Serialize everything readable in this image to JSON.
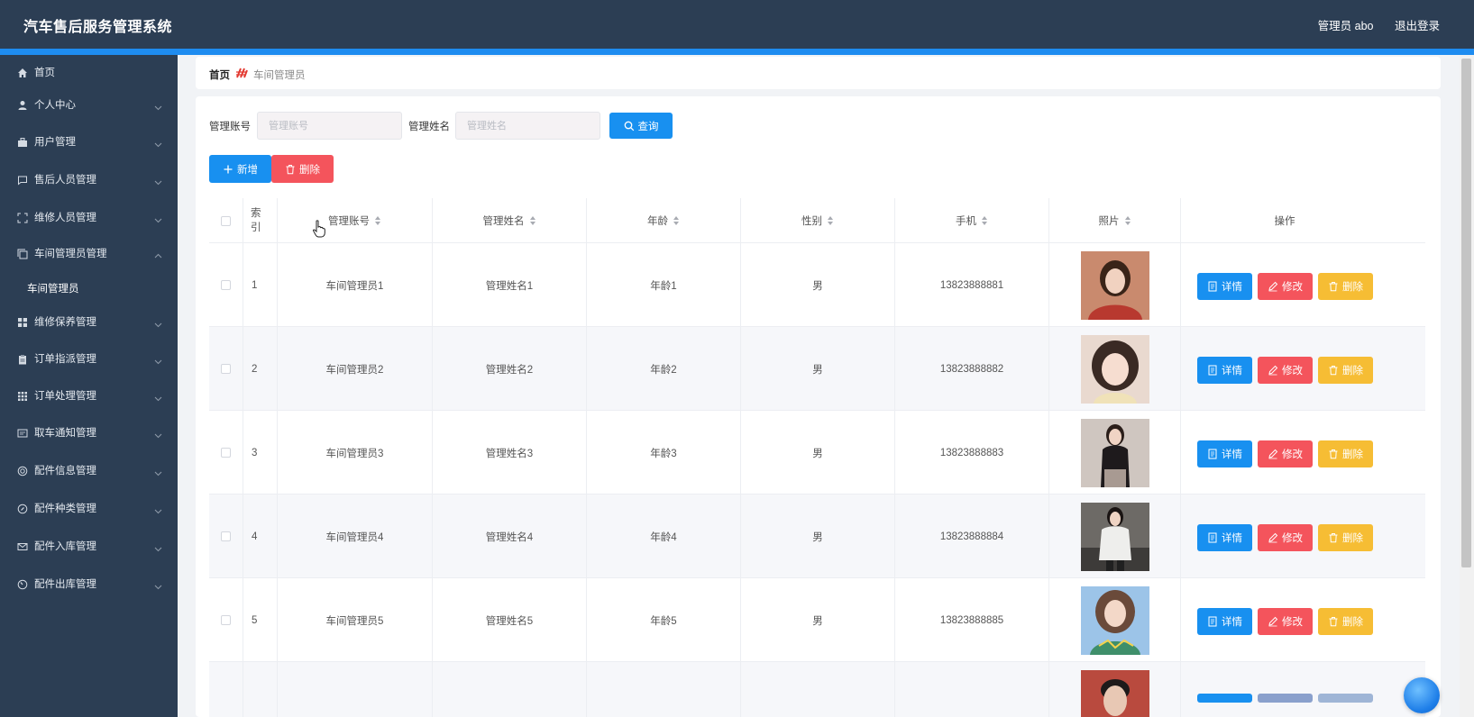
{
  "app": {
    "title": "汽车售后服务管理系统",
    "user_label": "管理员 abo",
    "logout_label": "退出登录"
  },
  "sidebar": {
    "items": [
      {
        "label": "首页",
        "icon": "home-icon"
      },
      {
        "label": "个人中心",
        "icon": "user-icon"
      },
      {
        "label": "用户管理",
        "icon": "users-icon"
      },
      {
        "label": "售后人员管理",
        "icon": "chat-icon"
      },
      {
        "label": "维修人员管理",
        "icon": "fullscreen-icon"
      },
      {
        "label": "车间管理员管理",
        "icon": "copy-icon"
      },
      {
        "label": "维修保养管理",
        "icon": "grid-icon"
      },
      {
        "label": "订单指派管理",
        "icon": "clipboard-icon"
      },
      {
        "label": "订单处理管理",
        "icon": "apps-icon"
      },
      {
        "label": "取车通知管理",
        "icon": "message-icon"
      },
      {
        "label": "配件信息管理",
        "icon": "circle-icon"
      },
      {
        "label": "配件种类管理",
        "icon": "compass-icon"
      },
      {
        "label": "配件入库管理",
        "icon": "mail-icon"
      },
      {
        "label": "配件出库管理",
        "icon": "gauge-icon"
      }
    ],
    "sub_item": "车间管理员"
  },
  "breadcrumb": {
    "home": "首页",
    "current": "车间管理员"
  },
  "search": {
    "account_label": "管理账号",
    "account_placeholder": "管理账号",
    "name_label": "管理姓名",
    "name_placeholder": "管理姓名",
    "query_label": "查询"
  },
  "toolbar": {
    "add_label": "新增",
    "delete_label": "删除"
  },
  "table": {
    "headers": {
      "index": "索引",
      "account": "管理账号",
      "name": "管理姓名",
      "age": "年龄",
      "gender": "性别",
      "phone": "手机",
      "photo": "照片",
      "actions": "操作"
    },
    "actions": {
      "detail": "详情",
      "edit": "修改",
      "delete": "删除"
    },
    "rows": [
      {
        "index": "1",
        "account": "车间管理员1",
        "name": "管理姓名1",
        "age": "年龄1",
        "gender": "男",
        "phone": "13823888881"
      },
      {
        "index": "2",
        "account": "车间管理员2",
        "name": "管理姓名2",
        "age": "年龄2",
        "gender": "男",
        "phone": "13823888882"
      },
      {
        "index": "3",
        "account": "车间管理员3",
        "name": "管理姓名3",
        "age": "年龄3",
        "gender": "男",
        "phone": "13823888883"
      },
      {
        "index": "4",
        "account": "车间管理员4",
        "name": "管理姓名4",
        "age": "年龄4",
        "gender": "男",
        "phone": "13823888884"
      },
      {
        "index": "5",
        "account": "车间管理员5",
        "name": "管理姓名5",
        "age": "年龄5",
        "gender": "男",
        "phone": "13823888885"
      }
    ]
  },
  "colors": {
    "header_bg": "#2c3e54",
    "accent": "#1890f0",
    "danger": "#f4545c",
    "warning": "#f6bd34"
  }
}
